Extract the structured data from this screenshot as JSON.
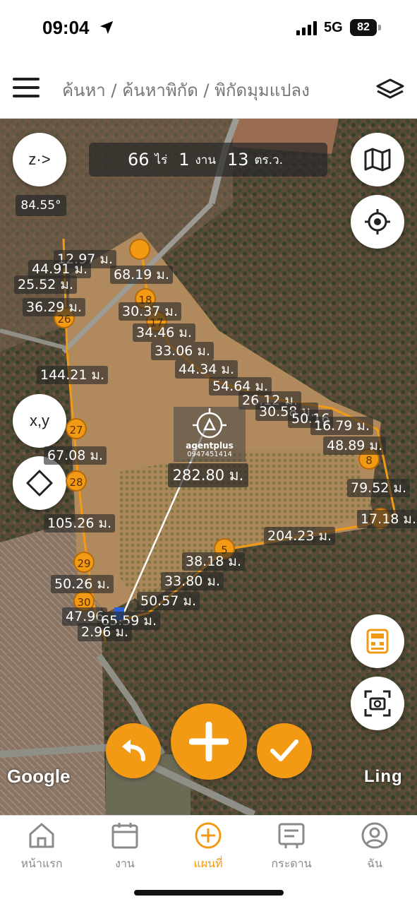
{
  "status_bar": {
    "time": "09:04",
    "network": "5G",
    "battery": "82"
  },
  "header": {
    "breadcrumb": "ค้นหา / ค้นหาพิกัด / พิกัดมุมแปลง"
  },
  "map": {
    "compass_label": "z·>",
    "heading": "84.55°",
    "area": {
      "rai": "66",
      "rai_unit": "ไร่",
      "ngan": "1",
      "ngan_unit": "งาน",
      "wa": "13",
      "wa_unit": "ตร.ว."
    },
    "xy_label": "x,y",
    "brand": {
      "name": "agentplus",
      "phone": "0947451414"
    },
    "center_distance": "282.80 ม.",
    "google_label": "Google",
    "ling_label": "Ling",
    "labels": [
      {
        "id": "l-1297",
        "text": "12.97 ม."
      },
      {
        "id": "l-6819",
        "text": "68.19 ม."
      },
      {
        "id": "l-4491",
        "text": "44.91 ม."
      },
      {
        "id": "l-2552",
        "text": "25.52 ม."
      },
      {
        "id": "l-3629",
        "text": "36.29 ม."
      },
      {
        "id": "l-3037",
        "text": "30.37 ม."
      },
      {
        "id": "l-3446",
        "text": "34.46 ม."
      },
      {
        "id": "l-3306",
        "text": "33.06 ม."
      },
      {
        "id": "l-14421",
        "text": "144.21 ม."
      },
      {
        "id": "l-4434",
        "text": "44.34 ม."
      },
      {
        "id": "l-5464",
        "text": "54.64 ม."
      },
      {
        "id": "l-2612",
        "text": "26.12 ม."
      },
      {
        "id": "l-3058",
        "text": "30.58 ม."
      },
      {
        "id": "l-5016",
        "text": "50.16"
      },
      {
        "id": "l-1679",
        "text": "16.79 ม."
      },
      {
        "id": "l-4889",
        "text": "48.89 ม."
      },
      {
        "id": "l-6708",
        "text": "67.08 ม."
      },
      {
        "id": "l-7952",
        "text": "79.52 ม."
      },
      {
        "id": "l-1718",
        "text": "17.18 ม."
      },
      {
        "id": "l-10526",
        "text": "105.26 ม."
      },
      {
        "id": "l-20423",
        "text": "204.23 ม."
      },
      {
        "id": "l-3818",
        "text": "38.18 ม."
      },
      {
        "id": "l-3380",
        "text": "33.80 ม."
      },
      {
        "id": "l-5026",
        "text": "50.26 ม."
      },
      {
        "id": "l-5057",
        "text": "50.57 ม."
      },
      {
        "id": "l-4796",
        "text": "47.96"
      },
      {
        "id": "l-6559",
        "text": "65.59 ม."
      },
      {
        "id": "l-296",
        "text": "2.96 ม."
      }
    ],
    "markers": [
      {
        "id": "m-top",
        "text": ""
      },
      {
        "id": "m-18",
        "text": "18"
      },
      {
        "id": "m-17",
        "text": "17"
      },
      {
        "id": "m-26",
        "text": "26"
      },
      {
        "id": "m-27",
        "text": "27"
      },
      {
        "id": "m-28",
        "text": "28"
      },
      {
        "id": "m-29",
        "text": "29"
      },
      {
        "id": "m-30",
        "text": "30"
      },
      {
        "id": "m-5",
        "text": "5"
      },
      {
        "id": "m-8",
        "text": "8"
      },
      {
        "id": "m-right",
        "text": ""
      }
    ]
  },
  "bottom_nav": [
    {
      "label": "หน้าแรก",
      "active": false
    },
    {
      "label": "งาน",
      "active": false
    },
    {
      "label": "แผนที่",
      "active": true
    },
    {
      "label": "กระดาน",
      "active": false
    },
    {
      "label": "ฉัน",
      "active": false
    }
  ],
  "colors": {
    "accent": "#f39a15",
    "nav_inactive": "#8a8a8a"
  }
}
